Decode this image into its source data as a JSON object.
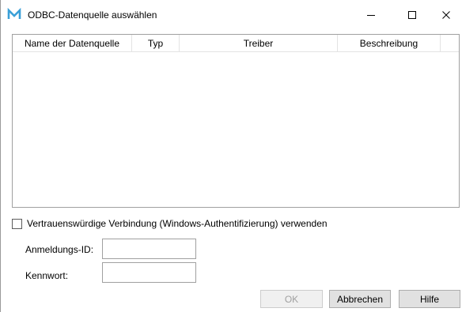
{
  "window": {
    "title": "ODBC-Datenquelle auswählen",
    "icon": "m-logo-icon",
    "accent": "#3aa0d8"
  },
  "list": {
    "columns": [
      "Name der Datenquelle",
      "Typ",
      "Treiber",
      "Beschreibung"
    ],
    "rows": []
  },
  "trusted_connection": {
    "label": "Vertrauenswürdige Verbindung (Windows-Authentifizierung) verwenden",
    "checked": false
  },
  "login": {
    "label": "Anmeldungs-ID:",
    "value": ""
  },
  "password": {
    "label": "Kennwort:",
    "value": ""
  },
  "buttons": {
    "ok": "OK",
    "cancel": "Abbrechen",
    "help": "Hilfe"
  }
}
